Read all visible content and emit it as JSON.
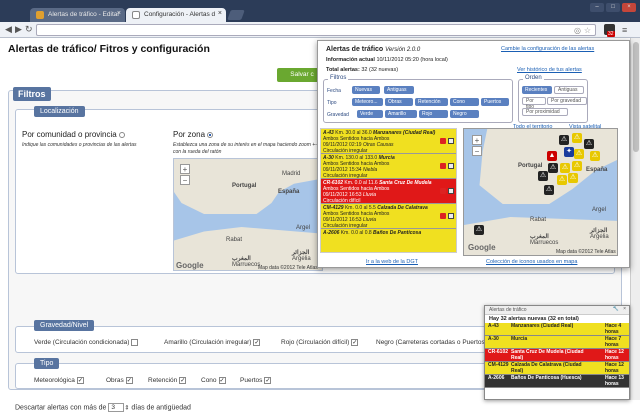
{
  "browser": {
    "tabs": [
      {
        "title": "Alertas de tráfico - Editar"
      },
      {
        "title": "Configuración - Alertas d"
      }
    ],
    "extension_badge": "32"
  },
  "page": {
    "title": "Alertas de tráfico/ Fitros y configuración",
    "save_label": "Salvar c",
    "filtros": {
      "legend": "Filtros",
      "localizacion": {
        "legend": "Localización",
        "by_community": "Por comunidad o provincia",
        "by_community_help": "Indique las comunidades o provincias de las alertas",
        "by_zone": "Por zona",
        "by_zone_help": "Establezca una zona de su interés en el mapa haciendo zoom +- o con la rueda del ratón",
        "map": {
          "labels": [
            "Portugal",
            "España",
            "Madrid",
            "Rabat",
            "Argel",
            "Marruecos",
            "Argelia"
          ],
          "labels_ar": [
            "المغرب",
            "الجزائر"
          ],
          "footer": "Map data ©2012 Tele Atlas",
          "google": "Google"
        }
      },
      "gravedad": {
        "legend": "Gravedad/Nivel",
        "items": [
          {
            "label": "Verde (Circulación condicionada)",
            "checked": false
          },
          {
            "label": "Amarillo (Circulación irregular)",
            "checked": true
          },
          {
            "label": "Rojo (Circulación difícil)",
            "checked": true
          },
          {
            "label": "Negro (Carreteras cortadas o Puertos ...",
            "checked": true
          }
        ]
      },
      "tipo": {
        "legend": "Tipo",
        "items": [
          {
            "label": "Meteorológica",
            "checked": true
          },
          {
            "label": "Obras",
            "checked": true
          },
          {
            "label": "Retención",
            "checked": true
          },
          {
            "label": "Cono",
            "checked": true
          },
          {
            "label": "Puertos",
            "checked": true
          }
        ]
      },
      "descartar": {
        "prefix": "Descartar alertas con más de",
        "value": "3",
        "suffix": "días de antigüedad"
      }
    }
  },
  "popup": {
    "title": "Alertas de tráfico",
    "version": "Versión 2.0.0",
    "config_link": "Cambie la configuración de las alertas",
    "info_label": "Información actual",
    "info_value": "10/11/2012 05:20 (hora local)",
    "total_label": "Total alertas:",
    "total_value": "32 (32 nuevas)",
    "history_link": "Ver histórico de tus alertas",
    "filtros": {
      "legend": "Filtros",
      "fecha_label": "Fecha",
      "fecha": [
        "Nuevas",
        "Antiguas"
      ],
      "tipo_label": "Tipo",
      "tipo": [
        "Meteoro...",
        "Obras",
        "Retención",
        "Cono",
        "Puertos"
      ],
      "gravedad_label": "Gravedad",
      "gravedad": [
        "Verde",
        "Amarillo",
        "Rojo",
        "Negro"
      ]
    },
    "orden": {
      "legend": "Orden",
      "row1": [
        "Recientes",
        "Antiguas"
      ],
      "row2": [
        "Por tipo",
        "Por gravedad"
      ],
      "row3": [
        "Por proximidad"
      ]
    },
    "todo_link": "Todo el territorio",
    "vista_link": "Vista satelital",
    "alerts": [
      {
        "road": "A-43",
        "km": "Km. 30.0 al 36.0",
        "place": "Manzanares (Ciudad Real)",
        "dir": "Ambos Sentidos hacia Ambos",
        "date": "09/11/2012 02:19",
        "cause": "Otras Causas",
        "level": "Circulación irregular",
        "color": "y"
      },
      {
        "road": "A-30",
        "km": "Km. 130.0 al 133.0",
        "place": "Murcia",
        "dir": "Ambos Sentidos hacia Ambos",
        "date": "09/11/2012 15:34",
        "cause": "Niebla",
        "level": "Circulación irregular",
        "color": "y"
      },
      {
        "road": "CR-6102",
        "km": "Km. 0.0 al 11.6",
        "place": "Santa Cruz De Mudela",
        "dir": "Ambos Sentidos hacia Ambos",
        "date": "09/11/2012 16:53",
        "cause": "Lluvia",
        "level": "Circulación difícil",
        "color": "r"
      },
      {
        "road": "CM-4129",
        "km": "Km. 0.0 al 5.5",
        "place": "Calzada De Calatrava",
        "dir": "Ambos Sentidos hacia Ambos",
        "date": "09/11/2012 16:53",
        "cause": "Lluvia",
        "level": "Circulación irregular",
        "color": "y"
      },
      {
        "road": "A-2606",
        "km": "Km. 0.0 al 0.8",
        "place": "Baños De Panticosa",
        "dir": "",
        "date": "",
        "cause": "",
        "level": "",
        "color": "y"
      }
    ],
    "dgt_link": "Ir a la web de la DGT",
    "icons_link": "Colección de iconos usados en mapa",
    "map_labels": [
      "Portugal",
      "España",
      "Marruecos",
      "Argelia",
      "Rabat",
      "Argel"
    ],
    "map_labels_ar": [
      "المغرب",
      "الجزائر"
    ],
    "map_footer": "Map data ©2012 Tele Atlas",
    "google": "Google"
  },
  "mini": {
    "header": "Alertas de tráfico",
    "total": "Hay 32 alertas nuevas (32 en total)",
    "rows": [
      {
        "road": "A-43",
        "place": "Manzanares (Ciudad Real)",
        "time": "Hace 4 horas",
        "color": "y"
      },
      {
        "road": "A-30",
        "place": "Murcia",
        "time": "Hace 7 horas",
        "color": "y"
      },
      {
        "road": "CR-6102",
        "place": "Santa Cruz De Mudela (Ciudad Real)",
        "time": "Hace 12 horas",
        "color": "r"
      },
      {
        "road": "CM-4129",
        "place": "Calzada De Calatrava (Ciudad Real)",
        "time": "Hace 12 horas",
        "color": "y"
      },
      {
        "road": "A-2606",
        "place": "Baños De Panticosa (Huesca)",
        "time": "Hace 13 horas",
        "color": "d"
      }
    ]
  }
}
